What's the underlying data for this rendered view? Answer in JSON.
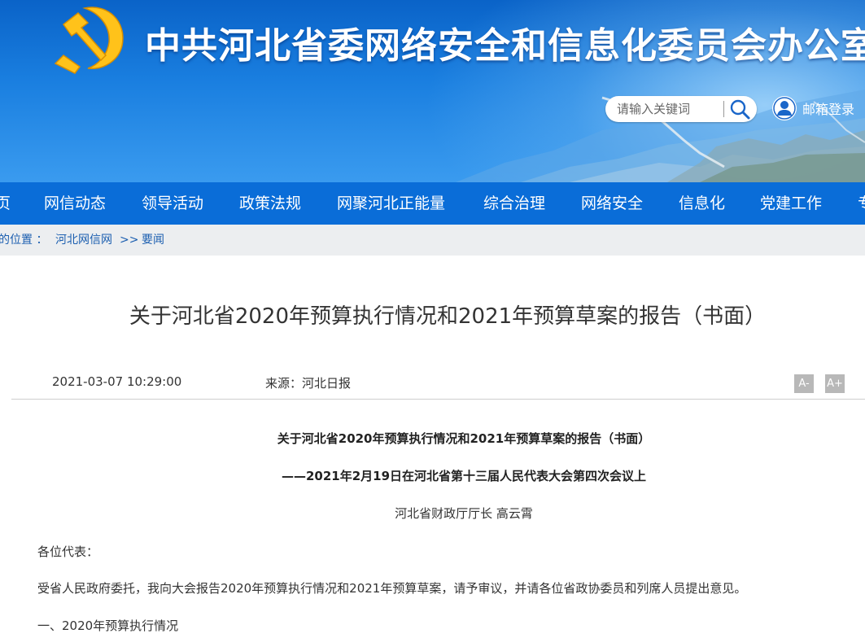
{
  "header": {
    "site_title": "中共河北省委网络安全和信息化委员会办公室",
    "search_placeholder": "请输入关键词",
    "mail_login": "邮箱登录"
  },
  "nav": {
    "items": [
      {
        "label": "页"
      },
      {
        "label": "网信动态"
      },
      {
        "label": "领导活动"
      },
      {
        "label": "政策法规"
      },
      {
        "label": "网聚河北正能量"
      },
      {
        "label": "综合治理"
      },
      {
        "label": "网络安全"
      },
      {
        "label": "信息化"
      },
      {
        "label": "党建工作"
      },
      {
        "label": "专"
      }
    ]
  },
  "breadcrumb": {
    "prefix": "的位置 ：",
    "site": "河北网信网",
    "separator": ">>",
    "section": "要闻"
  },
  "article": {
    "title": "关于河北省2020年预算执行情况和2021年预算草案的报告（书面）",
    "date": "2021-03-07 10:29:00",
    "source": "来源：河北日报",
    "font_decrease": "A-",
    "font_increase": "A+",
    "body_title": "关于河北省2020年预算执行情况和2021年预算草案的报告（书面）",
    "body_subtitle": "——2021年2月19日在河北省第十三届人民代表大会第四次会议上",
    "author": "河北省财政厅厅长 高云霄",
    "greeting": "各位代表：",
    "intro": "受省人民政府委托，我向大会报告2020年预算执行情况和2021年预算草案，请予审议，并请各位省政协委员和列席人员提出意见。",
    "section1": "一、2020年预算执行情况"
  },
  "colors": {
    "banner_top": "#0a63c8",
    "nav_bg": "#0a6dd8",
    "emblem_gold": "#ffc21a",
    "link_blue": "#1c5fb0"
  }
}
